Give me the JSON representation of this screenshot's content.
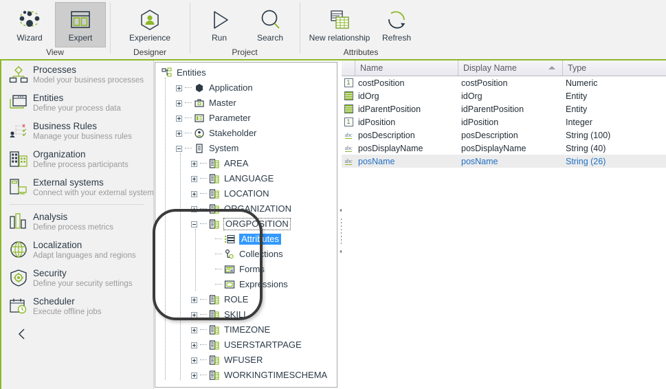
{
  "ribbon": {
    "groups": [
      {
        "label": "View",
        "buttons": [
          {
            "label": "Wizard",
            "icon": "wizard-icon",
            "active": false
          },
          {
            "label": "Expert",
            "icon": "expert-icon",
            "active": true
          }
        ]
      },
      {
        "label": "Designer",
        "buttons": [
          {
            "label": "Experience",
            "icon": "experience-icon",
            "active": false
          }
        ]
      },
      {
        "label": "Project",
        "buttons": [
          {
            "label": "Run",
            "icon": "run-icon",
            "active": false
          },
          {
            "label": "Search",
            "icon": "search-icon",
            "active": false
          }
        ]
      },
      {
        "label": "Attributes",
        "buttons": [
          {
            "label": "New relationship",
            "icon": "new-relationship-icon",
            "active": false
          },
          {
            "label": "Refresh",
            "icon": "refresh-icon",
            "active": false
          }
        ]
      }
    ]
  },
  "sidebar": {
    "items": [
      {
        "title": "Processes",
        "subtitle": "Model your business processes",
        "icon": "processes-icon"
      },
      {
        "title": "Entities",
        "subtitle": "Define your process data",
        "icon": "entities-icon"
      },
      {
        "title": "Business Rules",
        "subtitle": "Manage your business rules",
        "icon": "business-rules-icon"
      },
      {
        "title": "Organization",
        "subtitle": "Define process participants",
        "icon": "organization-icon"
      },
      {
        "title": "External systems",
        "subtitle": "Connect with your external systems",
        "icon": "external-systems-icon"
      },
      {
        "title": "Analysis",
        "subtitle": "Define process metrics",
        "icon": "analysis-icon"
      },
      {
        "title": "Localization",
        "subtitle": "Adapt languages and regions",
        "icon": "localization-icon"
      },
      {
        "title": "Security",
        "subtitle": "Define your security settings",
        "icon": "security-icon"
      },
      {
        "title": "Scheduler",
        "subtitle": "Execute offline jobs",
        "icon": "scheduler-icon"
      }
    ],
    "collapse_label": "‹"
  },
  "tree": {
    "root": {
      "label": "Entities",
      "icon": "entities-root-icon"
    },
    "nodes": [
      {
        "label": "Application",
        "depth": 1,
        "expander": "plus",
        "icon": "application-icon"
      },
      {
        "label": "Master",
        "depth": 1,
        "expander": "plus",
        "icon": "master-icon"
      },
      {
        "label": "Parameter",
        "depth": 1,
        "expander": "plus",
        "icon": "parameter-icon"
      },
      {
        "label": "Stakeholder",
        "depth": 1,
        "expander": "plus",
        "icon": "stakeholder-icon"
      },
      {
        "label": "System",
        "depth": 1,
        "expander": "minus",
        "icon": "system-icon"
      },
      {
        "label": "AREA",
        "depth": 2,
        "expander": "plus",
        "icon": "entity-icon"
      },
      {
        "label": "LANGUAGE",
        "depth": 2,
        "expander": "plus",
        "icon": "entity-icon"
      },
      {
        "label": "LOCATION",
        "depth": 2,
        "expander": "plus",
        "icon": "entity-icon"
      },
      {
        "label": "ORGANIZATION",
        "depth": 2,
        "expander": "plus",
        "icon": "entity-icon"
      },
      {
        "label": "ORGPOSITION",
        "depth": 2,
        "expander": "minus",
        "icon": "entity-icon",
        "focused": true
      },
      {
        "label": "Attributes",
        "depth": 3,
        "expander": "none",
        "icon": "attributes-icon",
        "selected": true
      },
      {
        "label": "Collections",
        "depth": 3,
        "expander": "none",
        "icon": "collections-icon"
      },
      {
        "label": "Forms",
        "depth": 3,
        "expander": "none",
        "icon": "forms-icon"
      },
      {
        "label": "Expressions",
        "depth": 3,
        "expander": "none",
        "icon": "expressions-icon"
      },
      {
        "label": "ROLE",
        "depth": 2,
        "expander": "plus",
        "icon": "entity-icon"
      },
      {
        "label": "SKILL",
        "depth": 2,
        "expander": "plus",
        "icon": "entity-icon"
      },
      {
        "label": "TIMEZONE",
        "depth": 2,
        "expander": "plus",
        "icon": "entity-icon"
      },
      {
        "label": "USERSTARTPAGE",
        "depth": 2,
        "expander": "plus",
        "icon": "entity-icon"
      },
      {
        "label": "WFUSER",
        "depth": 2,
        "expander": "plus",
        "icon": "entity-icon"
      },
      {
        "label": "WORKINGTIMESCHEMA",
        "depth": 2,
        "expander": "plus",
        "icon": "entity-icon"
      }
    ]
  },
  "grid": {
    "columns": [
      {
        "label": "",
        "key": "icon"
      },
      {
        "label": "Name",
        "key": "name"
      },
      {
        "label": "Display Name",
        "key": "display_name",
        "sorted": "asc"
      },
      {
        "label": "Type",
        "key": "type"
      }
    ],
    "rows": [
      {
        "icon": "numeric-icon",
        "name": "costPosition",
        "display_name": "costPosition",
        "type": "Numeric",
        "selected": false
      },
      {
        "icon": "entity-icon",
        "name": "idOrg",
        "display_name": "idOrg",
        "type": "Entity",
        "selected": false
      },
      {
        "icon": "entity-icon",
        "name": "idParentPosition",
        "display_name": "idParentPosition",
        "type": "Entity",
        "selected": false
      },
      {
        "icon": "numeric-icon",
        "name": "idPosition",
        "display_name": "idPosition",
        "type": "Integer",
        "selected": false
      },
      {
        "icon": "string-icon",
        "name": "posDescription",
        "display_name": "posDescription",
        "type": "String (100)",
        "selected": false
      },
      {
        "icon": "string-icon",
        "name": "posDisplayName",
        "display_name": "posDisplayName",
        "type": "String (40)",
        "selected": false
      },
      {
        "icon": "string-icon",
        "name": "posName",
        "display_name": "posName",
        "type": "String (26)",
        "selected": true
      }
    ]
  },
  "splitter": {
    "collapse_left_label": "◁",
    "collapse_right_label": "◁"
  },
  "colors": {
    "accent_green": "#8cb829",
    "header_bg": "#f2f2f2",
    "selection_blue": "#3399ff",
    "row_select_text": "#1f6fc4",
    "text_dark": "#2b3a47",
    "text_muted": "#9a9a9a"
  }
}
